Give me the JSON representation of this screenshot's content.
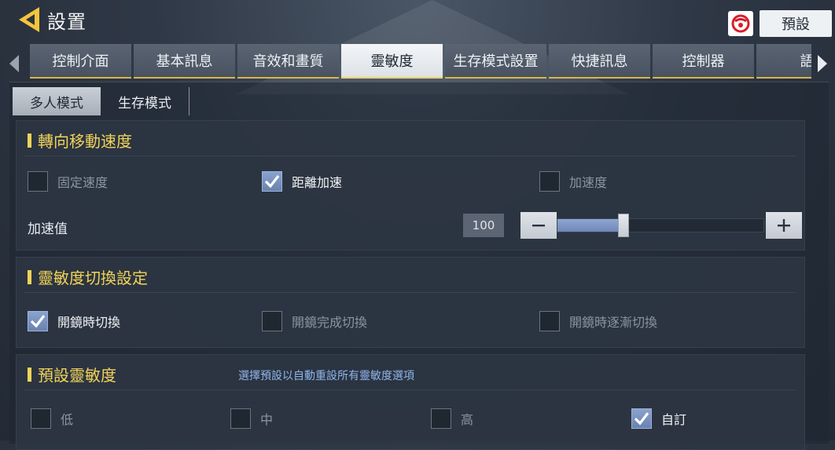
{
  "header": {
    "title": "設置",
    "preset_button": "預設"
  },
  "tabs": [
    {
      "label": "控制介面",
      "active": false
    },
    {
      "label": "基本訊息",
      "active": false
    },
    {
      "label": "音效和畫質",
      "active": false
    },
    {
      "label": "靈敏度",
      "active": true
    },
    {
      "label": "生存模式設置",
      "active": false
    },
    {
      "label": "快捷訊息",
      "active": false
    },
    {
      "label": "控制器",
      "active": false
    },
    {
      "label": "語",
      "active": false
    }
  ],
  "subtabs": [
    {
      "label": "多人模式",
      "active": true
    },
    {
      "label": "生存模式",
      "active": false
    }
  ],
  "turn_speed": {
    "title": "轉向移動速度",
    "options": [
      {
        "label": "固定速度",
        "checked": false
      },
      {
        "label": "距離加速",
        "checked": true
      },
      {
        "label": "加速度",
        "checked": false
      }
    ],
    "accel_label": "加速值",
    "accel_value": "100",
    "slider_fraction": 0.32
  },
  "switch_settings": {
    "title": "靈敏度切換設定",
    "options": [
      {
        "label": "開鏡時切換",
        "checked": true
      },
      {
        "label": "開鏡完成切換",
        "checked": false
      },
      {
        "label": "開鏡時逐漸切換",
        "checked": false
      }
    ]
  },
  "preset_sens": {
    "title": "預設靈敏度",
    "subtitle": "選擇預設以自動重設所有靈敏度選項",
    "options": [
      {
        "label": "低",
        "checked": false
      },
      {
        "label": "中",
        "checked": false
      },
      {
        "label": "高",
        "checked": false
      },
      {
        "label": "自訂",
        "checked": true
      }
    ]
  },
  "colors": {
    "accent": "#f2d35a",
    "check": "#7a92c0",
    "subtitle": "#8fb4ea"
  },
  "icons": [
    "back-arrow-icon",
    "brand-logo-icon",
    "tab-left-arrow-icon",
    "tab-right-arrow-icon",
    "checkmark-icon",
    "minus-icon",
    "plus-icon"
  ]
}
